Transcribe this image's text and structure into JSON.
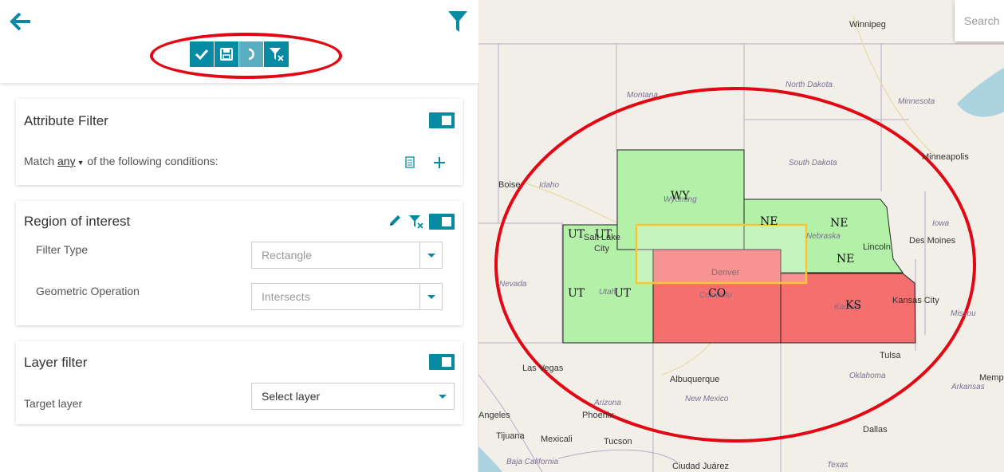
{
  "toolbar": {
    "apply": "check-icon",
    "save": "save-icon",
    "undo": "undo-icon",
    "clear": "clear-filter-icon"
  },
  "attribute_filter": {
    "title": "Attribute Filter",
    "match_prefix": "Match",
    "match_value": "any",
    "match_suffix": "of the following conditions:"
  },
  "region_of_interest": {
    "title": "Region of interest",
    "filter_type_label": "Filter Type",
    "filter_type_value": "Rectangle",
    "geometric_operation_label": "Geometric Operation",
    "geometric_operation_value": "Intersects"
  },
  "layer_filter": {
    "title": "Layer filter",
    "target_layer_label": "Target layer",
    "target_layer_value": "Select layer"
  },
  "map": {
    "search_placeholder": "Search",
    "cities": {
      "winnipeg": "Winnipeg",
      "minneapolis": "Minneapolis",
      "boise": "Boise",
      "des_moines": "Des Moines",
      "lincoln": "Lincoln",
      "salt_lake": "Salt Lake",
      "city": "City",
      "denver": "Denver",
      "kansas_city": "Kansas City",
      "las_vegas": "Las Vegas",
      "albuquerque": "Albuquerque",
      "tulsa": "Tulsa",
      "memphis": "Memp",
      "angeles": "Angeles",
      "phoenix": "Phoenix",
      "tijuana": "Tijuana",
      "mexicali": "Mexicali",
      "tucson": "Tucson",
      "dallas": "Dallas",
      "ciudad_juarez": "Ciudad Juárez"
    },
    "regions": {
      "montana": "Montana",
      "north_dakota": "North Dakota",
      "minnesota": "Minnesota",
      "south_dakota": "South Dakota",
      "idaho": "Idaho",
      "wyoming": "Wyoming",
      "nebraska": "Nebraska",
      "iowa": "Iowa",
      "nevada": "Nevada",
      "utah": "Utah",
      "colorado": "Colorado",
      "kansas": "Kansas",
      "missouri": "Missou",
      "oklahoma": "Oklahoma",
      "arkansas": "Arkansas",
      "new_mexico": "New Mexico",
      "arizona": "Arizona",
      "baja_california": "Baja California",
      "texas": "Texas"
    },
    "features": {
      "wy": "WY",
      "ne1": "NE",
      "ne2": "NE",
      "ne3": "NE",
      "ut1": "UT",
      "ut2": "UT",
      "ut3": "UT",
      "ut4": "UT",
      "co": "CO",
      "ks": "KS"
    },
    "colors": {
      "match": "#b3f0a8",
      "nonmatch": "#f56f6f",
      "roi": "#f7c631",
      "highlight": "#e30613"
    }
  }
}
